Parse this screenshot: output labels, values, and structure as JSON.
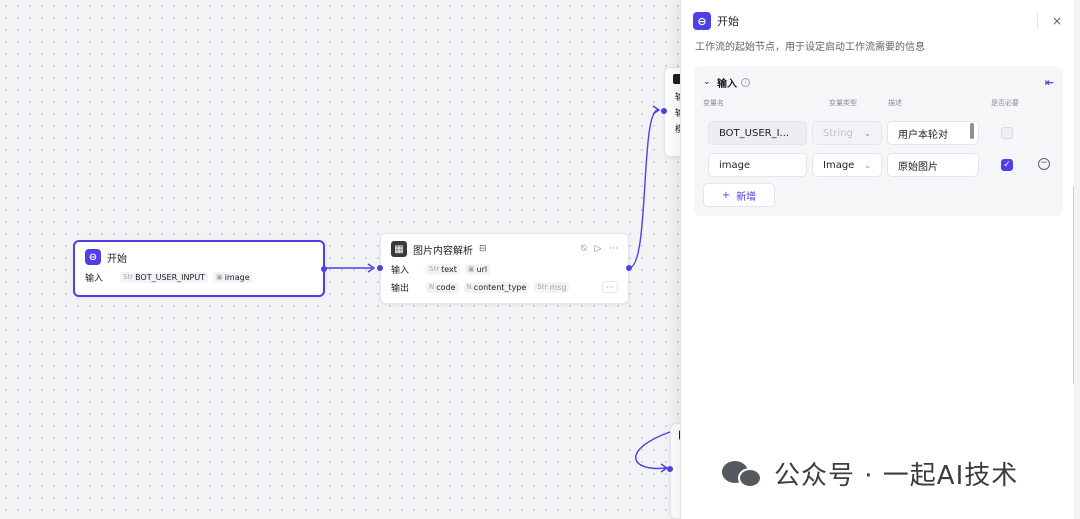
{
  "start_node": {
    "title": "开始",
    "input_label": "输入",
    "inputs": [
      {
        "type": "Str",
        "name": "BOT_USER_INPUT"
      },
      {
        "type": "img-icon",
        "name": "image"
      }
    ]
  },
  "image_node": {
    "title": "图片内容解析",
    "input_label": "输入",
    "output_label": "输出",
    "inputs": [
      {
        "type": "Str",
        "name": "text"
      },
      {
        "type": "img-icon",
        "name": "url"
      }
    ],
    "outputs": [
      {
        "type": "N",
        "name": "code"
      },
      {
        "type": "N",
        "name": "content_type"
      },
      {
        "type": "Str",
        "name": "msg"
      }
    ],
    "more": "···"
  },
  "peek_top": {
    "lines": [
      "输",
      "输",
      "模"
    ]
  },
  "panel": {
    "title": "开始",
    "description": "工作流的起始节点，用于设定启动工作流需要的信息",
    "close": "×",
    "section": {
      "title": "输入",
      "columns": {
        "name": "变量名",
        "type": "变量类型",
        "desc": "描述",
        "required": "是否必要"
      },
      "rows": [
        {
          "name": "BOT_USER_I...",
          "type": "String",
          "desc": "用户本轮对",
          "required": false,
          "disabled": true
        },
        {
          "name": "image",
          "type": "Image",
          "desc": "原始图片",
          "required": true,
          "disabled": false
        }
      ],
      "add_label": "新增"
    }
  },
  "watermark": {
    "text": "公众号 · 一起AI技术"
  },
  "colors": {
    "accent": "#4e40e5",
    "canvas": "#f2f3f5"
  }
}
